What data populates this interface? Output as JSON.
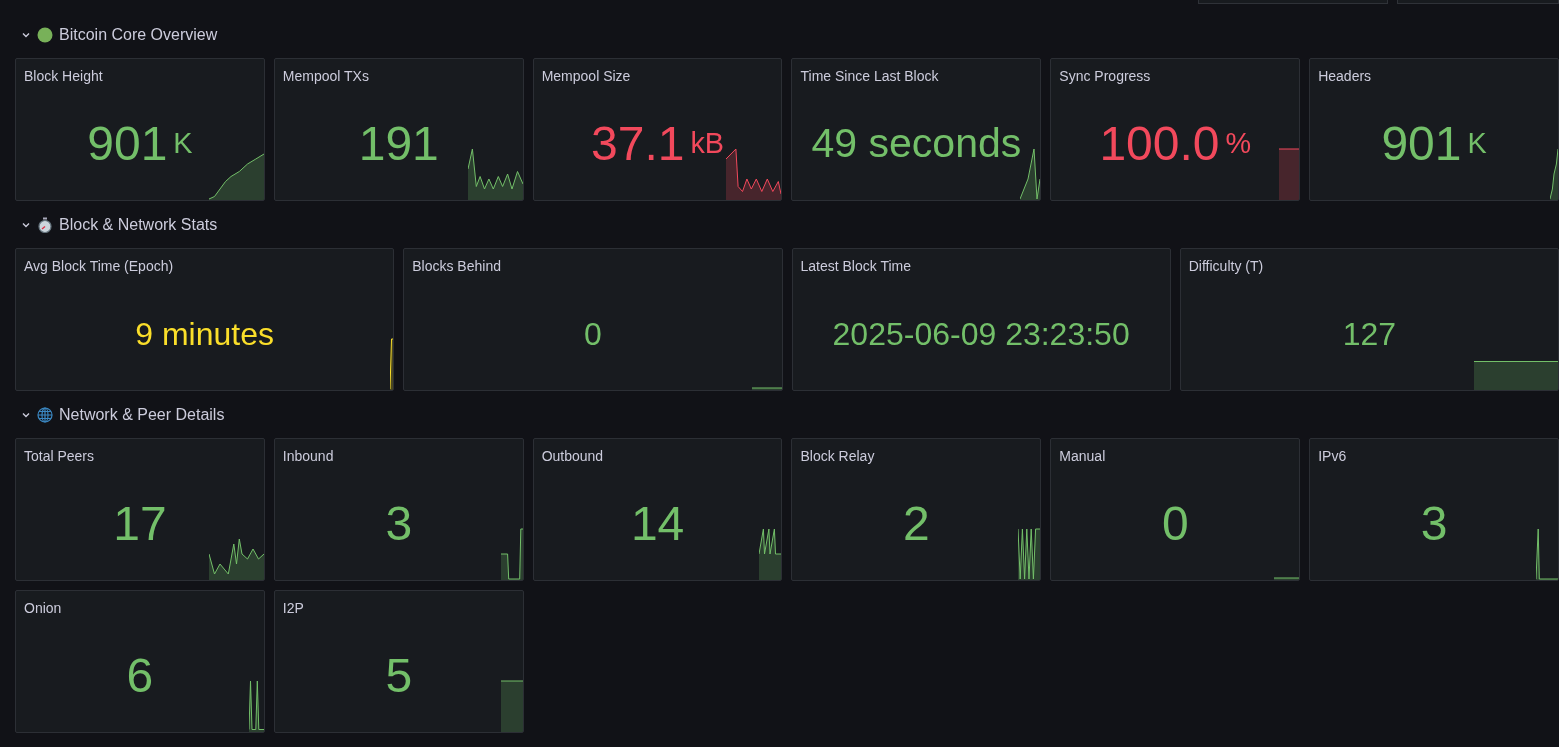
{
  "sections": [
    {
      "title": "Bitcoin Core Overview",
      "kind": "dot",
      "expanded": true,
      "panels": [
        {
          "title": "Block Height",
          "value": "901",
          "unit": "K",
          "color": "#73bf69"
        },
        {
          "title": "Mempool TXs",
          "value": "191",
          "color": "#73bf69"
        },
        {
          "title": "Mempool Size",
          "value": "37.1",
          "unit": "kB",
          "color": "#f2495c"
        },
        {
          "title": "Time Since Last Block",
          "value": "49 seconds",
          "color": "#73bf69"
        },
        {
          "title": "Sync Progress",
          "value": "100.0",
          "unit": "%",
          "color": "#f2495c"
        },
        {
          "title": "Headers",
          "value": "901",
          "unit": "K",
          "color": "#73bf69"
        }
      ]
    },
    {
      "title": "Block & Network Stats",
      "kind": "stopwatch",
      "expanded": true,
      "panels": [
        {
          "title": "Avg Block Time (Epoch)",
          "value": "9 minutes",
          "color": "#fade2a"
        },
        {
          "title": "Blocks Behind",
          "value": "0",
          "color": "#73bf69"
        },
        {
          "title": "Latest Block Time",
          "value": "2025-06-09 23:23:50",
          "color": "#73bf69"
        },
        {
          "title": "Difficulty (T)",
          "value": "127",
          "color": "#73bf69"
        }
      ]
    },
    {
      "title": "Network & Peer Details",
      "kind": "globe",
      "expanded": true,
      "panels": [
        {
          "title": "Total Peers",
          "value": "17",
          "color": "#73bf69"
        },
        {
          "title": "Inbound",
          "value": "3",
          "color": "#73bf69"
        },
        {
          "title": "Outbound",
          "value": "14",
          "color": "#73bf69"
        },
        {
          "title": "Block Relay",
          "value": "2",
          "color": "#73bf69"
        },
        {
          "title": "Manual",
          "value": "0",
          "color": "#73bf69"
        },
        {
          "title": "IPv6",
          "value": "3",
          "color": "#73bf69"
        },
        {
          "title": "Onion",
          "value": "6",
          "color": "#73bf69"
        },
        {
          "title": "I2P",
          "value": "5",
          "color": "#73bf69"
        }
      ]
    }
  ]
}
